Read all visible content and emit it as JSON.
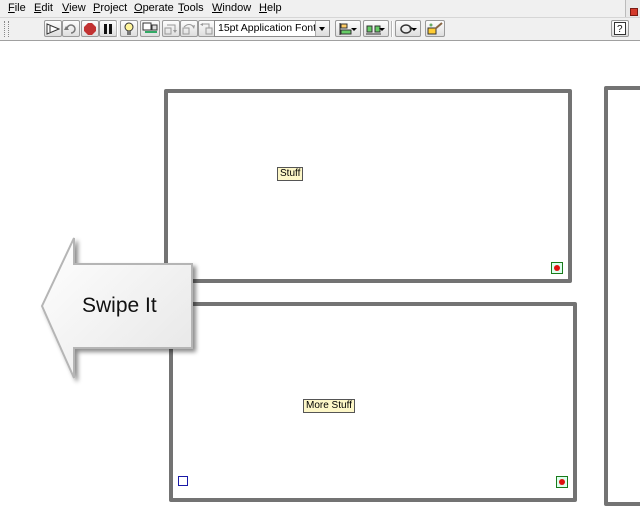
{
  "menu": {
    "items": [
      {
        "id": "file",
        "label": "File",
        "accel": "F",
        "rest": "ile"
      },
      {
        "id": "edit",
        "label": "Edit",
        "accel": "E",
        "rest": "dit"
      },
      {
        "id": "view",
        "label": "View",
        "accel": "V",
        "rest": "iew"
      },
      {
        "id": "project",
        "label": "Project",
        "accel": "P",
        "rest": "roject"
      },
      {
        "id": "operate",
        "label": "Operate",
        "accel": "O",
        "rest": "perate"
      },
      {
        "id": "tools",
        "label": "Tools",
        "accel": "T",
        "rest": "ools"
      },
      {
        "id": "window",
        "label": "Window",
        "accel": "W",
        "rest": "indow"
      },
      {
        "id": "help",
        "label": "Help",
        "accel": "H",
        "rest": "elp"
      }
    ]
  },
  "toolbar": {
    "font_select": "15pt Application Font",
    "icons": {
      "run": "run-arrow-icon",
      "run_continuously": "run-continuously-icon",
      "abort": "abort-icon",
      "pause": "pause-icon",
      "highlight": "highlight-execution-icon",
      "retain_wire": "retain-wire-values-icon",
      "step_into": "step-into-icon",
      "step_over": "step-over-icon",
      "step_out": "step-out-icon",
      "align": "align-objects-icon",
      "distribute": "distribute-objects-icon",
      "reorder": "reorder-icon",
      "cleanup": "clean-up-diagram-icon",
      "context_help": "context-help-icon"
    }
  },
  "diagram": {
    "top_frame_label": "Stuff",
    "bottom_frame_label": "More Stuff",
    "callout_text": "Swipe It"
  },
  "colors": {
    "frame_border": "#737373",
    "label_bg": "#fdf7c8",
    "stop_red": "#e01010"
  }
}
